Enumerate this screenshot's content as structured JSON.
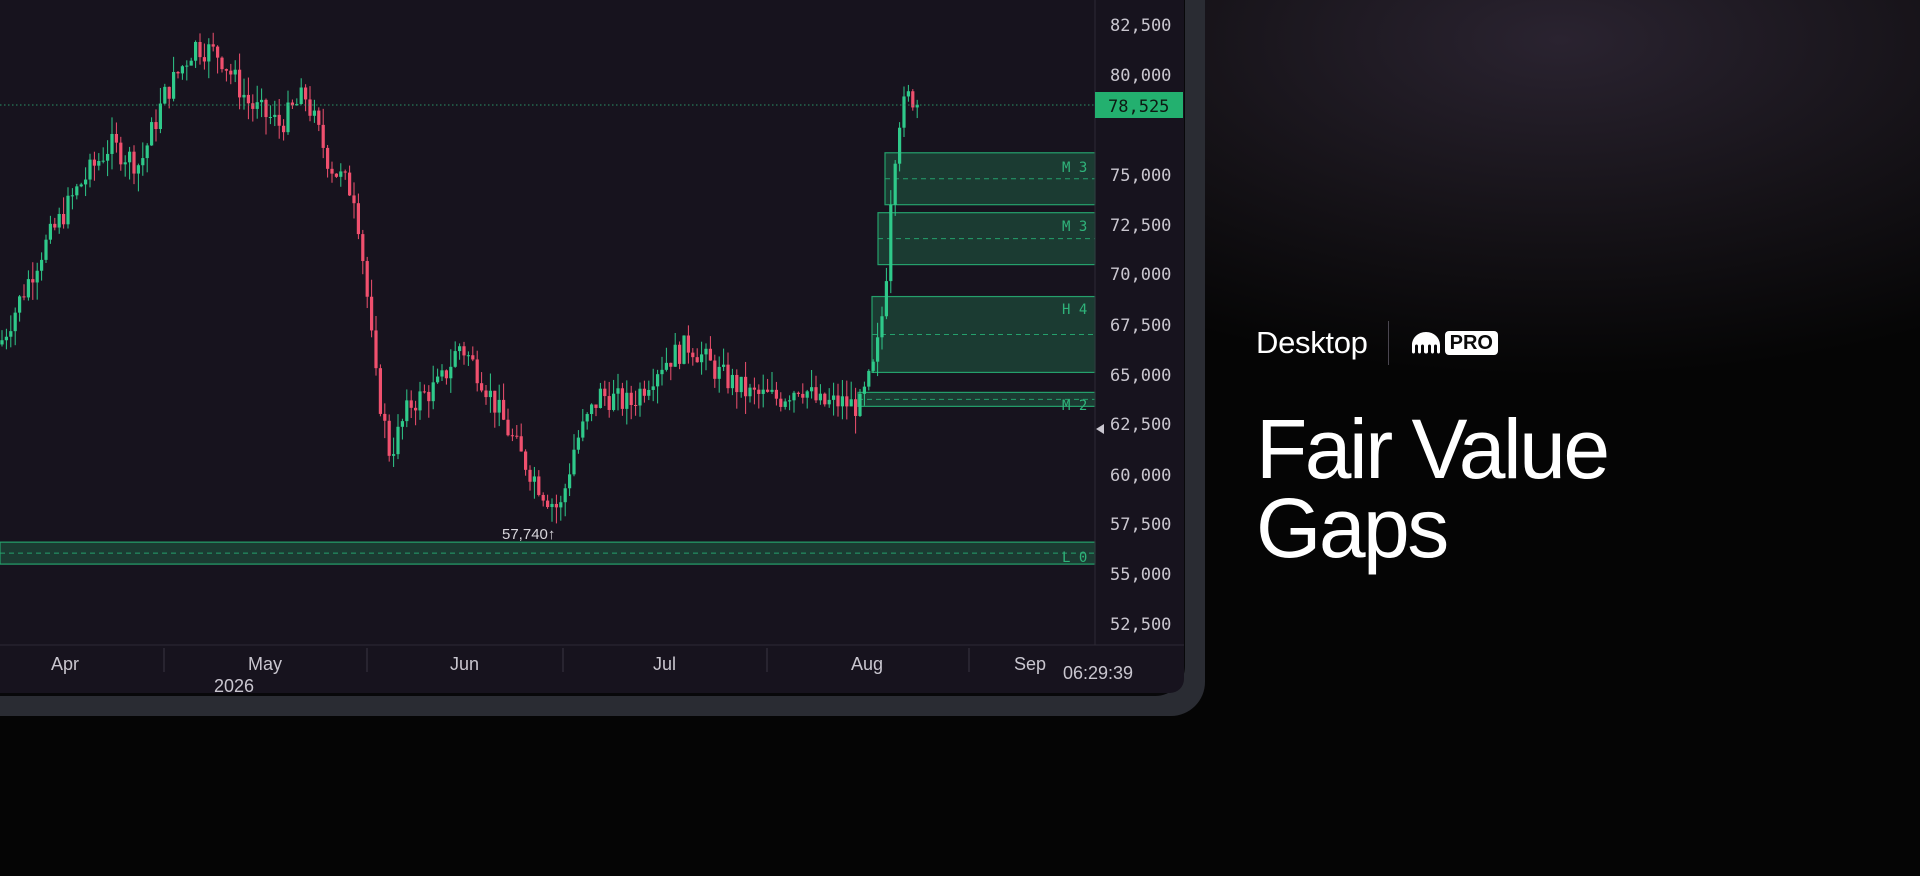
{
  "price_axis": {
    "labels": [
      "82,500",
      "80,000",
      "75,000",
      "72,500",
      "70,000",
      "67,500",
      "65,000",
      "62,500",
      "60,000",
      "57,500",
      "55,000",
      "52,500"
    ],
    "current_price": "78,525"
  },
  "time_axis": {
    "months": [
      "Apr",
      "May",
      "Jun",
      "Jul",
      "Aug",
      "Sep"
    ],
    "year": "2026",
    "clock": "06:29:39"
  },
  "chart": {
    "low_marker": "57,740↑",
    "fvg_labels": [
      "M 3",
      "M 3",
      "H 4",
      "M 2",
      "L 0"
    ],
    "colors": {
      "up": "#2fc98a",
      "down": "#f0506e",
      "fvg_fill": "#1d4a3a",
      "fvg_border": "#25a06c",
      "price_tag": "#23b06f"
    }
  },
  "chart_data": {
    "type": "candlestick",
    "x_range": [
      "2026-03",
      "2026-09"
    ],
    "ylim": [
      52500,
      82500
    ],
    "current_price": 78525,
    "period_low": 57740,
    "fair_value_gaps": [
      {
        "label": "M 3",
        "low": 73500,
        "high": 76100
      },
      {
        "label": "M 3",
        "low": 70500,
        "high": 73100
      },
      {
        "label": "H 4",
        "low": 65100,
        "high": 68900
      },
      {
        "label": "M 2",
        "low": 63400,
        "high": 64100
      },
      {
        "label": "L 0",
        "low": 55500,
        "high": 56600
      }
    ]
  },
  "promo": {
    "platform_label": "Desktop",
    "badge": "PRO",
    "title_line1": "Fair Value",
    "title_line2": "Gaps"
  }
}
